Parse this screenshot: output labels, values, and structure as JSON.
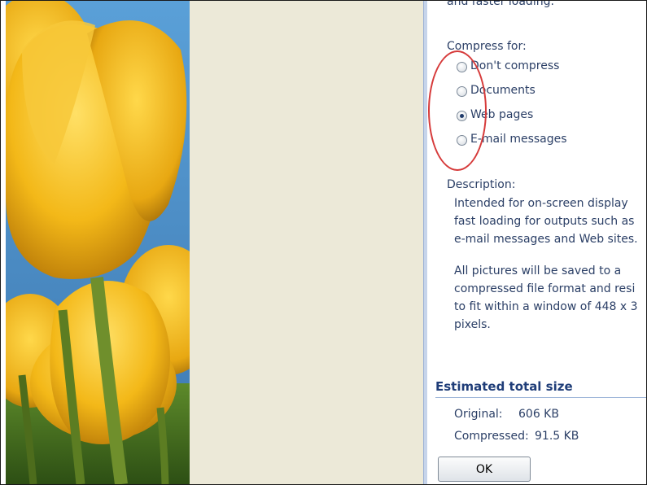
{
  "options_panel": {
    "cut_text": "and faster loading.",
    "compress_heading": "Compress for:",
    "options": [
      {
        "label": "Don't compress",
        "selected": false
      },
      {
        "label": "Documents",
        "selected": false
      },
      {
        "label": "Web pages",
        "selected": true
      },
      {
        "label": "E-mail messages",
        "selected": false
      }
    ],
    "description_heading": "Description:",
    "description_lines": [
      "Intended for on-screen display",
      "fast loading for outputs such as",
      "e-mail messages and Web sites."
    ],
    "description_lines_2": [
      "All pictures will be saved to a",
      "compressed file format and resi",
      "to fit within a window of 448 x 3",
      "pixels."
    ]
  },
  "estimate": {
    "title": "Estimated total size",
    "original_label": "Original:",
    "original_value": "606 KB",
    "compressed_label": "Compressed:",
    "compressed_value": "91.5 KB"
  },
  "buttons": {
    "ok_label": "OK"
  },
  "colors": {
    "panel_text": "#2b3f66",
    "section_title": "#1f3d78",
    "annotation": "#d63a3a",
    "beige": "#ece9d8"
  }
}
